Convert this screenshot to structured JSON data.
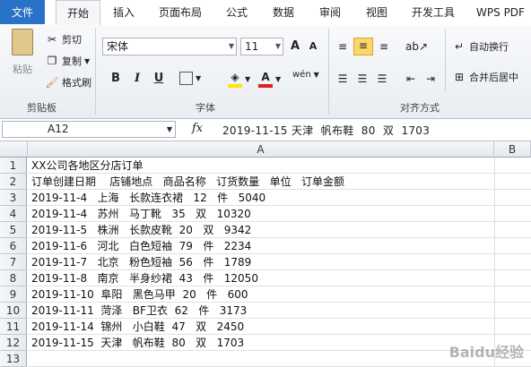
{
  "tabs": [
    "文件",
    "开始",
    "插入",
    "页面布局",
    "公式",
    "数据",
    "审阅",
    "视图",
    "开发工具",
    "WPS PDF"
  ],
  "clipboard": {
    "paste": "粘贴",
    "cut": "剪切",
    "copy": "复制",
    "format_painter": "格式刷",
    "group": "剪贴板"
  },
  "font": {
    "name": "宋体",
    "size": "11",
    "bold": "B",
    "italic": "I",
    "underline": "U",
    "grow": "A",
    "shrink": "A",
    "wen": "wén",
    "group": "字体"
  },
  "alignment": {
    "wrap": "自动换行",
    "merge": "合并后居中",
    "group": "对齐方式"
  },
  "formula_bar": {
    "cell_ref": "A12",
    "fx": "fx",
    "content": "2019-11-15 天津  帆布鞋  80  双  1703"
  },
  "columns": [
    "A",
    "B"
  ],
  "rows": [
    {
      "num": "1",
      "text": "XX公司各地区分店订单"
    },
    {
      "num": "2",
      "text": "订单创建日期    店铺地点   商品名称   订货数量   单位   订单金额"
    },
    {
      "num": "3",
      "text": "2019-11-4   上海   长款连衣裙   12   件   5040"
    },
    {
      "num": "4",
      "text": "2019-11-4   苏州   马丁靴   35   双   10320"
    },
    {
      "num": "5",
      "text": "2019-11-5   株洲   长款皮靴  20   双   9342"
    },
    {
      "num": "6",
      "text": "2019-11-6   河北   白色短袖  79   件   2234"
    },
    {
      "num": "7",
      "text": "2019-11-7   北京   粉色短袖  56   件   1789"
    },
    {
      "num": "8",
      "text": "2019-11-8   南京   半身纱裙  43   件   12050"
    },
    {
      "num": "9",
      "text": "2019-11-10  阜阳   黑色马甲  20   件   600"
    },
    {
      "num": "10",
      "text": "2019-11-11  菏泽   BF卫衣  62   件   3173"
    },
    {
      "num": "11",
      "text": "2019-11-14  锦州   小白鞋  47   双   2450"
    },
    {
      "num": "12",
      "text": "2019-11-15  天津   帆布鞋  80   双   1703"
    },
    {
      "num": "13",
      "text": ""
    }
  ],
  "watermark": "Baidu经验"
}
